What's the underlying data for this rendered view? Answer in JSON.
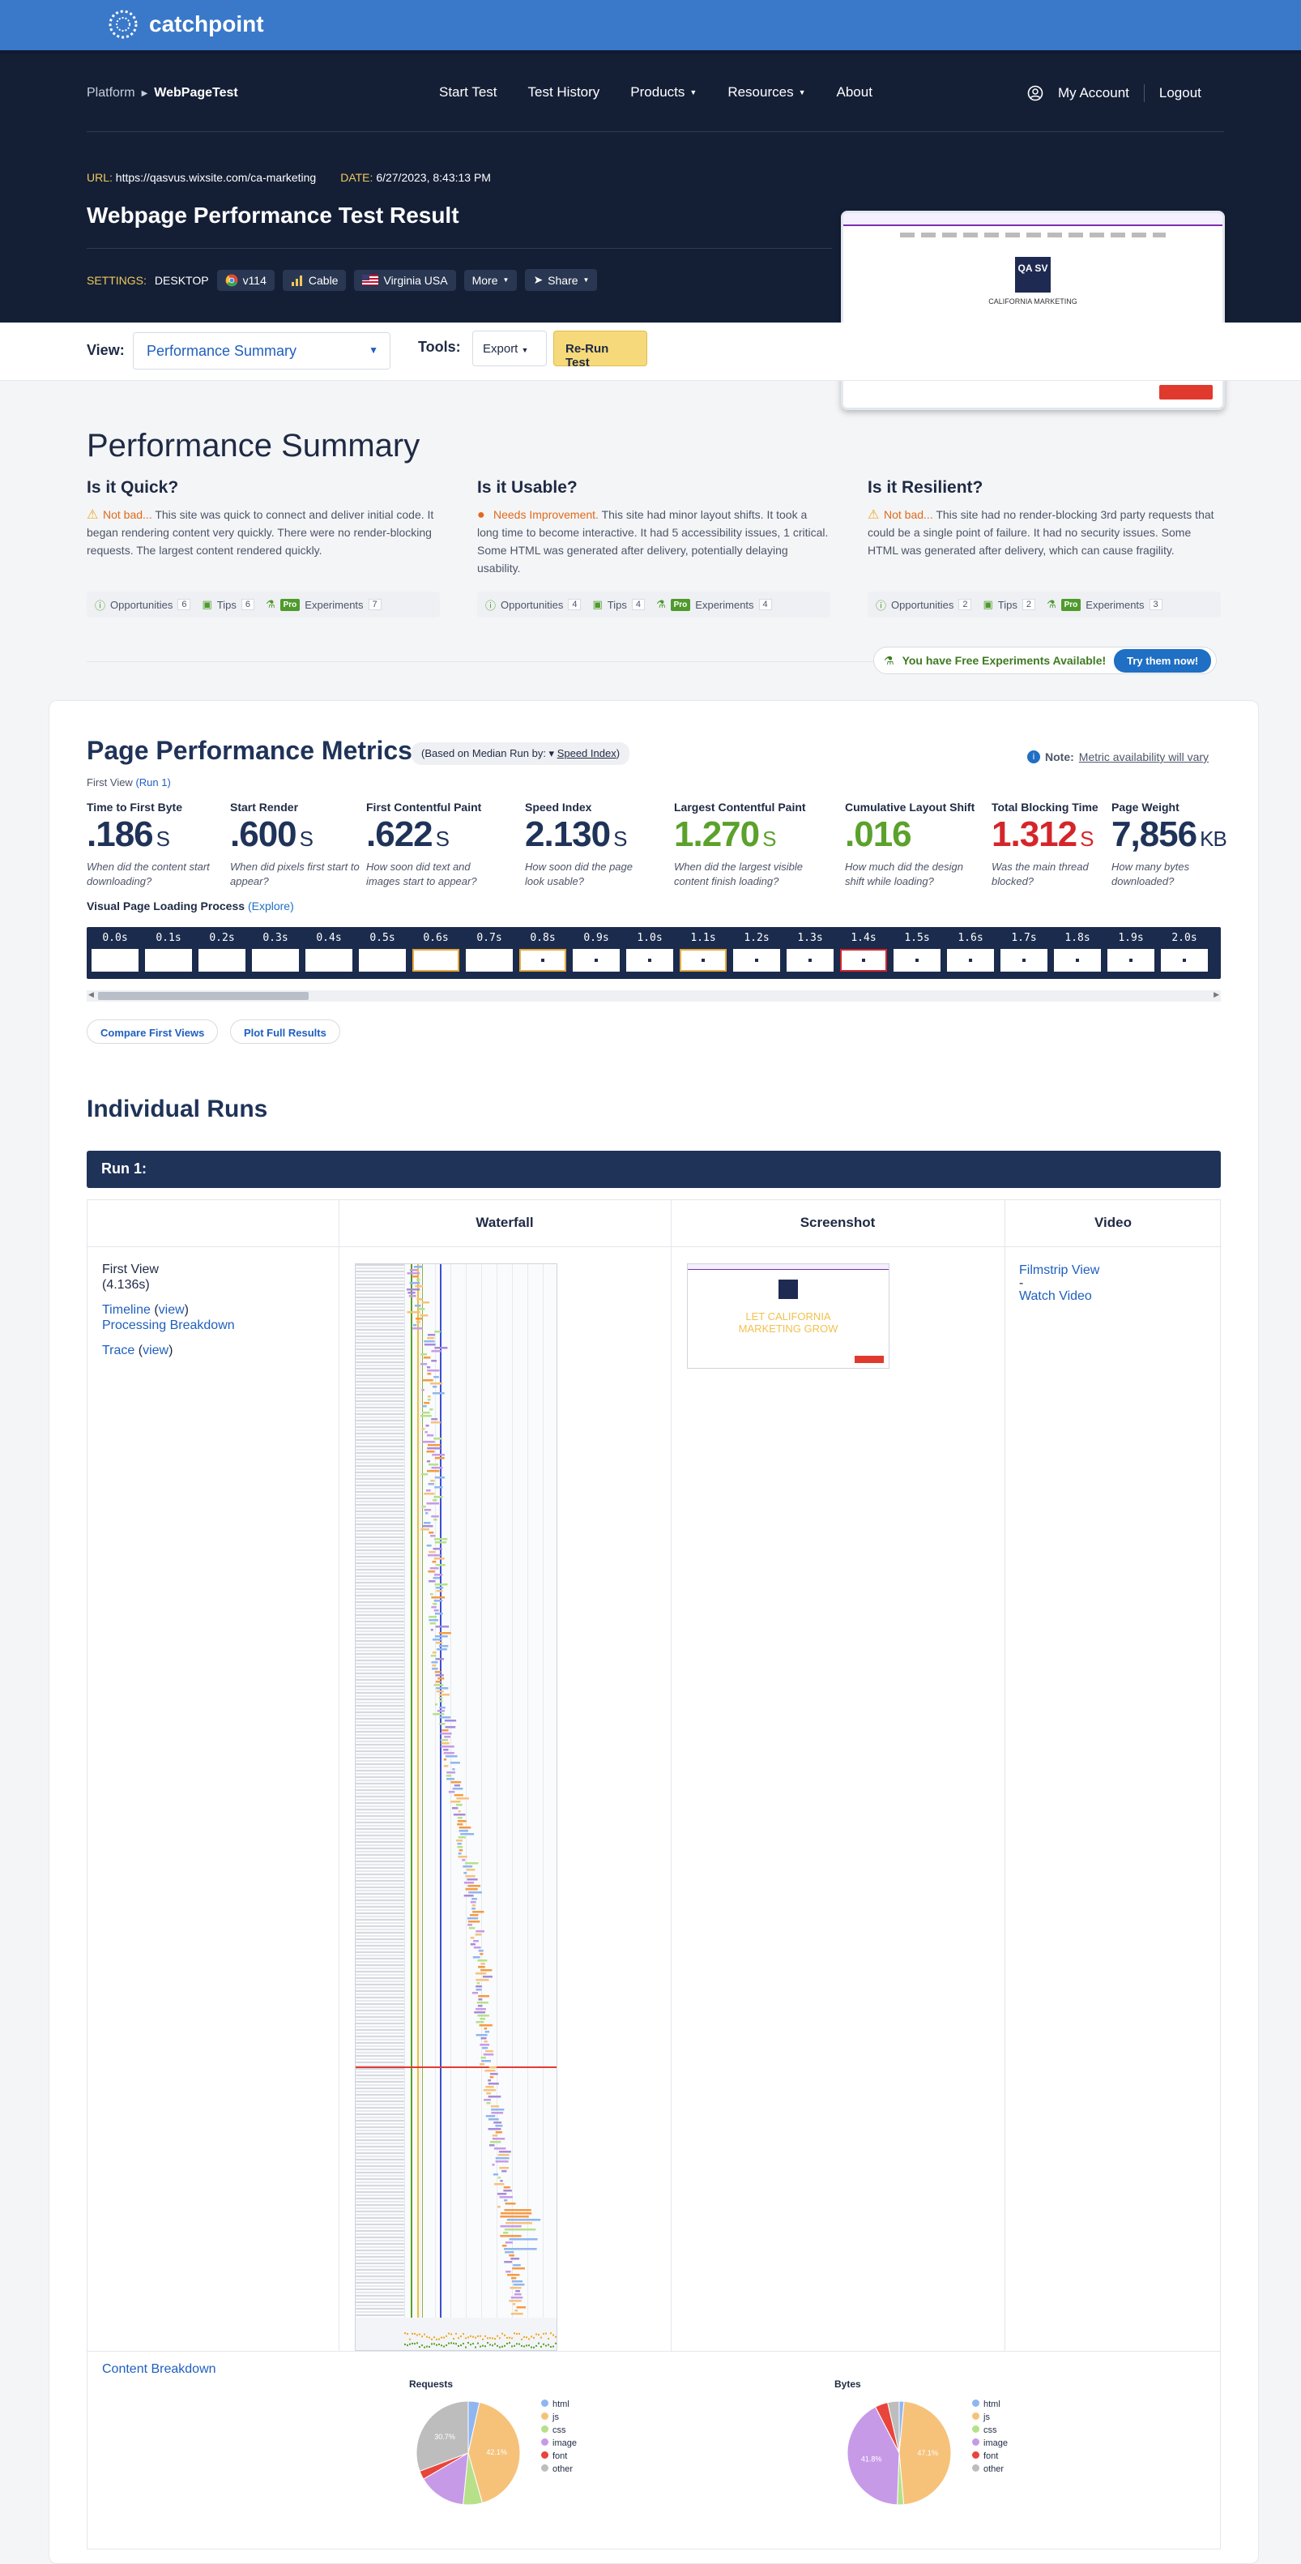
{
  "brand": {
    "name": "catchpoint"
  },
  "breadcrumb": {
    "platform": "Platform",
    "current": "WebPageTest"
  },
  "nav": {
    "start_test": "Start Test",
    "test_history": "Test History",
    "products": "Products",
    "resources": "Resources",
    "about": "About"
  },
  "account": {
    "my_account": "My Account",
    "logout": "Logout"
  },
  "result": {
    "url_label": "URL:",
    "url": "https://qasvus.wixsite.com/ca-marketing",
    "date_label": "DATE:",
    "date": "6/27/2023, 8:43:13 PM",
    "title": "Webpage Performance Test Result"
  },
  "settings": {
    "label": "SETTINGS:",
    "device": "DESKTOP",
    "browser": "v114",
    "connection": "Cable",
    "location": "Virginia USA",
    "more": "More",
    "share": "Share"
  },
  "thumbnail": {
    "headline": "LET CALIFORNIA MARKETING GROW",
    "logo": "QA SV",
    "org": "CALIFORNIA MARKETING"
  },
  "toolbar": {
    "view_label": "View:",
    "view_value": "Performance Summary",
    "tools_label": "Tools:",
    "export": "Export",
    "rerun": "Re-Run Test"
  },
  "summary": {
    "title": "Performance Summary",
    "columns": [
      {
        "heading": "Is it Quick?",
        "verdict": "Not bad...",
        "text": "This site was quick to connect and deliver initial code. It began rendering content very quickly. There were no render-blocking requests. The largest content rendered quickly.",
        "opportunities": "Opportunities",
        "opp_count": "6",
        "tips": "Tips",
        "tips_count": "6",
        "experiments": "Experiments",
        "exp_count": "7"
      },
      {
        "heading": "Is it Usable?",
        "verdict": "Needs Improvement.",
        "text": "This site had minor layout shifts. It took a long time to become interactive. It had 5 accessibility issues, 1 critical. Some HTML was generated after delivery, potentially delaying usability.",
        "opportunities": "Opportunities",
        "opp_count": "4",
        "tips": "Tips",
        "tips_count": "4",
        "experiments": "Experiments",
        "exp_count": "4"
      },
      {
        "heading": "Is it Resilient?",
        "verdict": "Not bad...",
        "text": "This site had no render-blocking 3rd party requests that could be a single point of failure. It had no security issues. Some HTML was generated after delivery, which can cause fragility.",
        "opportunities": "Opportunities",
        "opp_count": "2",
        "tips": "Tips",
        "tips_count": "2",
        "experiments": "Experiments",
        "exp_count": "3"
      }
    ],
    "pro_badge": "Pro",
    "free_experiments": "You have Free Experiments Available!",
    "try_now": "Try them now!"
  },
  "metrics": {
    "title": "Page Performance Metrics",
    "median_note": "(Based on Median Run by: ▾",
    "median_link": "Speed Index",
    "median_close": ")",
    "note_label": "Note:",
    "note_text": "Metric availability will vary",
    "first_view": "First View",
    "run_link": "(Run 1)",
    "items": [
      {
        "label": "Time to First Byte",
        "value": ".186",
        "unit": "S",
        "question": "When did the content start downloading?",
        "color": "#1f3359"
      },
      {
        "label": "Start Render",
        "value": ".600",
        "unit": "S",
        "question": "When did pixels first start to appear?",
        "color": "#1f3359"
      },
      {
        "label": "First Contentful Paint",
        "value": ".622",
        "unit": "S",
        "question": "How soon did text and images start to appear?",
        "color": "#1f3359"
      },
      {
        "label": "Speed Index",
        "value": "2.130",
        "unit": "S",
        "question": "How soon did the page look usable?",
        "color": "#1f3359"
      },
      {
        "label": "Largest Contentful Paint",
        "value": "1.270",
        "unit": "S",
        "question": "When did the largest visible content finish loading?",
        "color": "#5ba12b"
      },
      {
        "label": "Cumulative Layout Shift",
        "value": ".016",
        "unit": "",
        "question": "How much did the design shift while loading?",
        "color": "#5ba12b"
      },
      {
        "label": "Total Blocking Time",
        "value": "1.312",
        "unit": "S",
        "question": "Was the main thread blocked?",
        "color": "#d4262a"
      },
      {
        "label": "Page Weight",
        "value": "7,856",
        "unit": "KB",
        "question": "How many bytes downloaded?",
        "color": "#1f3359"
      }
    ],
    "visual_progress": "Visual Page Loading Process",
    "explore": "(Explore)",
    "filmstrip": [
      "0.0s",
      "0.1s",
      "0.2s",
      "0.3s",
      "0.4s",
      "0.5s",
      "0.6s",
      "0.7s",
      "0.8s",
      "0.9s",
      "1.0s",
      "1.1s",
      "1.2s",
      "1.3s",
      "1.4s",
      "1.5s",
      "1.6s",
      "1.7s",
      "1.8s",
      "1.9s",
      "2.0s"
    ],
    "compare": "Compare First Views",
    "plot": "Plot Full Results"
  },
  "runs": {
    "title": "Individual Runs",
    "run_label": "Run 1:",
    "col_waterfall": "Waterfall",
    "col_screenshot": "Screenshot",
    "col_video": "Video",
    "first_view": "First View",
    "duration": "(4.136s)",
    "timeline": "Timeline",
    "view1": "view",
    "processing": "Processing Breakdown",
    "trace": "Trace",
    "view2": "view",
    "filmstrip_view": "Filmstrip View",
    "dash": "-",
    "watch_video": "Watch Video",
    "content_breakdown": "Content Breakdown"
  },
  "pies": {
    "requests": {
      "title": "Requests",
      "center_label": "42.1%",
      "other_label": "30.7%"
    },
    "bytes": {
      "title": "Bytes",
      "center_label": "47.1%",
      "other_label": "41.8%"
    },
    "legend": [
      "html",
      "js",
      "css",
      "image",
      "font",
      "other"
    ],
    "colors": {
      "html": "#8fb6f0",
      "js": "#f6c27a",
      "css": "#b6e08a",
      "image": "#c79ae8",
      "font": "#e8453c",
      "other": "#bdbdbd"
    }
  },
  "chart_data": [
    {
      "type": "pie",
      "title": "Requests",
      "labels": [
        "html",
        "js",
        "css",
        "image",
        "font",
        "other"
      ],
      "values": [
        3.5,
        42.1,
        6.0,
        15.0,
        2.7,
        30.7
      ]
    },
    {
      "type": "pie",
      "title": "Bytes",
      "labels": [
        "html",
        "js",
        "css",
        "image",
        "font",
        "other"
      ],
      "values": [
        1.5,
        47.1,
        2.0,
        41.8,
        4.0,
        3.6
      ]
    }
  ]
}
